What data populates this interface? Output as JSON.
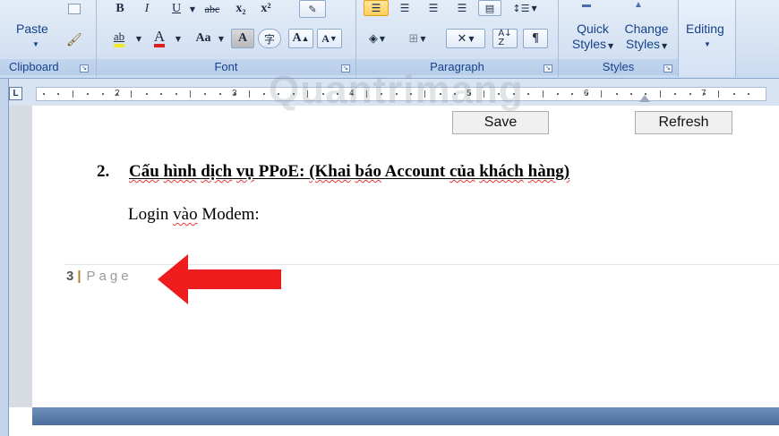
{
  "clipboard": {
    "paste_label": "Paste",
    "group_label": "Clipboard"
  },
  "font": {
    "group_label": "Font",
    "bold": "B",
    "italic": "I",
    "underline": "U",
    "strike": "abc",
    "subscript": "x₂",
    "superscript": "x²",
    "highlight": "ab",
    "font_color": "A",
    "change_case": "Aa",
    "char_shading": "A",
    "enclose": "字",
    "grow": "A",
    "shrink": "A"
  },
  "paragraph": {
    "group_label": "Paragraph",
    "pilcrow": "¶"
  },
  "styles": {
    "quick_1": "Quick",
    "quick_2": "Styles",
    "change_1": "Change",
    "change_2": "Styles",
    "group_label": "Styles"
  },
  "editing": {
    "label": "Editing"
  },
  "ruler": {
    "corner": "L",
    "numbers": [
      "2",
      "3",
      "4",
      "5",
      "6",
      "7"
    ]
  },
  "document": {
    "save_button": "Save",
    "refresh_button": "Refresh",
    "heading_number": "2.",
    "heading_words": [
      "Cấu",
      "hình",
      "dịch",
      "vụ",
      "PPoE:",
      "(Khai",
      "báo",
      "Account",
      "của",
      "khách",
      "hàng)"
    ],
    "body_prefix": "Login",
    "body_word": "vào",
    "body_suffix": "Modem:",
    "footer_page_number": "3",
    "footer_separator": "|",
    "footer_page_label": "Page"
  },
  "watermark": "Quantrimang",
  "colors": {
    "accent_arrow": "#ee1c1c",
    "ribbon": "#d6e3f3",
    "status_band": "#4b6e9e"
  }
}
